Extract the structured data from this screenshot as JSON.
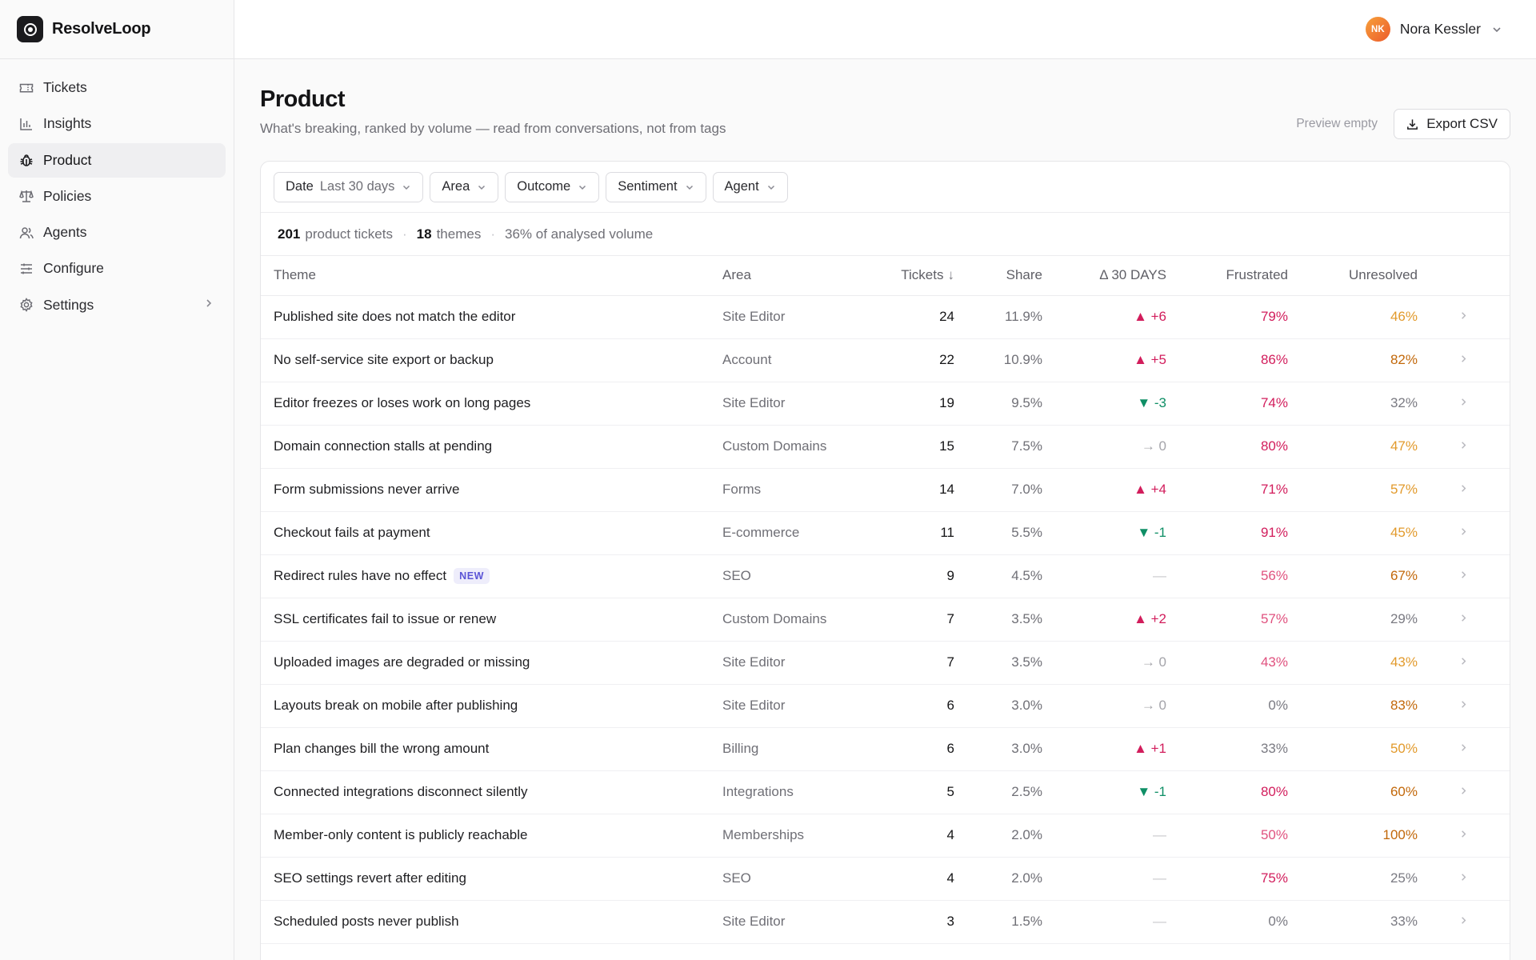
{
  "app": {
    "name": "ResolveLoop"
  },
  "sidebar": {
    "items": [
      {
        "label": "Tickets",
        "icon": "ticket-icon"
      },
      {
        "label": "Insights",
        "icon": "bar-chart-icon"
      },
      {
        "label": "Product",
        "icon": "bug-icon",
        "active": true
      },
      {
        "label": "Policies",
        "icon": "scale-icon"
      },
      {
        "label": "Agents",
        "icon": "users-icon"
      },
      {
        "label": "Configure",
        "icon": "sliders-icon"
      },
      {
        "label": "Settings",
        "icon": "gear-icon"
      }
    ]
  },
  "user": {
    "initials": "NK",
    "name": "Nora Kessler"
  },
  "page": {
    "title": "Product",
    "subtitle": "What's breaking, ranked by volume — read from conversations, not from tags",
    "preview_label": "Preview empty",
    "export_label": "Export CSV"
  },
  "filters": [
    {
      "label": "Date",
      "value": "Last 30 days"
    },
    {
      "label": "Area",
      "value": ""
    },
    {
      "label": "Outcome",
      "value": ""
    },
    {
      "label": "Sentiment",
      "value": ""
    },
    {
      "label": "Agent",
      "value": ""
    }
  ],
  "summary": {
    "tickets_count": "201",
    "tickets_label": "product tickets",
    "themes_count": "18",
    "themes_label": "themes",
    "volume_text": "36% of analysed volume"
  },
  "table": {
    "headers": {
      "theme": "Theme",
      "area": "Area",
      "tickets": "Tickets",
      "share": "Share",
      "delta": "Δ 30 DAYS",
      "frustrated": "Frustrated",
      "unresolved": "Unresolved"
    },
    "rows": [
      {
        "theme": "Published site does not match the editor",
        "area": "Site Editor",
        "tickets": "24",
        "share": "11.9%",
        "delta": "▲ +6",
        "delta_dir": "up",
        "frustrated": "79%",
        "unresolved": "46%"
      },
      {
        "theme": "No self-service site export or backup",
        "area": "Account",
        "tickets": "22",
        "share": "10.9%",
        "delta": "▲ +5",
        "delta_dir": "up",
        "frustrated": "86%",
        "unresolved": "82%"
      },
      {
        "theme": "Editor freezes or loses work on long pages",
        "area": "Site Editor",
        "tickets": "19",
        "share": "9.5%",
        "delta": "▼ -3",
        "delta_dir": "down",
        "frustrated": "74%",
        "unresolved": "32%"
      },
      {
        "theme": "Domain connection stalls at pending",
        "area": "Custom Domains",
        "tickets": "15",
        "share": "7.5%",
        "delta": "→ 0",
        "delta_dir": "flat",
        "frustrated": "80%",
        "unresolved": "47%"
      },
      {
        "theme": "Form submissions never arrive",
        "area": "Forms",
        "tickets": "14",
        "share": "7.0%",
        "delta": "▲ +4",
        "delta_dir": "up",
        "frustrated": "71%",
        "unresolved": "57%"
      },
      {
        "theme": "Checkout fails at payment",
        "area": "E-commerce",
        "tickets": "11",
        "share": "5.5%",
        "delta": "▼ -1",
        "delta_dir": "down",
        "frustrated": "91%",
        "unresolved": "45%"
      },
      {
        "theme": "Redirect rules have no effect",
        "badge": "NEW",
        "area": "SEO",
        "tickets": "9",
        "share": "4.5%",
        "delta": "—",
        "delta_dir": "none",
        "frustrated": "56%",
        "unresolved": "67%"
      },
      {
        "theme": "SSL certificates fail to issue or renew",
        "area": "Custom Domains",
        "tickets": "7",
        "share": "3.5%",
        "delta": "▲ +2",
        "delta_dir": "up",
        "frustrated": "57%",
        "unresolved": "29%"
      },
      {
        "theme": "Uploaded images are degraded or missing",
        "area": "Site Editor",
        "tickets": "7",
        "share": "3.5%",
        "delta": "→ 0",
        "delta_dir": "flat",
        "frustrated": "43%",
        "unresolved": "43%"
      },
      {
        "theme": "Layouts break on mobile after publishing",
        "area": "Site Editor",
        "tickets": "6",
        "share": "3.0%",
        "delta": "→ 0",
        "delta_dir": "flat",
        "frustrated": "0%",
        "unresolved": "83%"
      },
      {
        "theme": "Plan changes bill the wrong amount",
        "area": "Billing",
        "tickets": "6",
        "share": "3.0%",
        "delta": "▲ +1",
        "delta_dir": "up",
        "frustrated": "33%",
        "unresolved": "50%"
      },
      {
        "theme": "Connected integrations disconnect silently",
        "area": "Integrations",
        "tickets": "5",
        "share": "2.5%",
        "delta": "▼ -1",
        "delta_dir": "down",
        "frustrated": "80%",
        "unresolved": "60%"
      },
      {
        "theme": "Member-only content is publicly reachable",
        "area": "Memberships",
        "tickets": "4",
        "share": "2.0%",
        "delta": "—",
        "delta_dir": "none",
        "frustrated": "50%",
        "unresolved": "100%"
      },
      {
        "theme": "SEO settings revert after editing",
        "area": "SEO",
        "tickets": "4",
        "share": "2.0%",
        "delta": "—",
        "delta_dir": "none",
        "frustrated": "75%",
        "unresolved": "25%"
      },
      {
        "theme": "Scheduled posts never publish",
        "area": "Site Editor",
        "tickets": "3",
        "share": "1.5%",
        "delta": "—",
        "delta_dir": "none",
        "frustrated": "0%",
        "unresolved": "33%"
      }
    ]
  },
  "colors": {
    "frustrated_high": "#d21d5c",
    "frustrated_mid": "#e0527f",
    "unresolved_high": "#c2680a",
    "unresolved_mid": "#e29a2c",
    "neutral": "#7a7a82"
  }
}
